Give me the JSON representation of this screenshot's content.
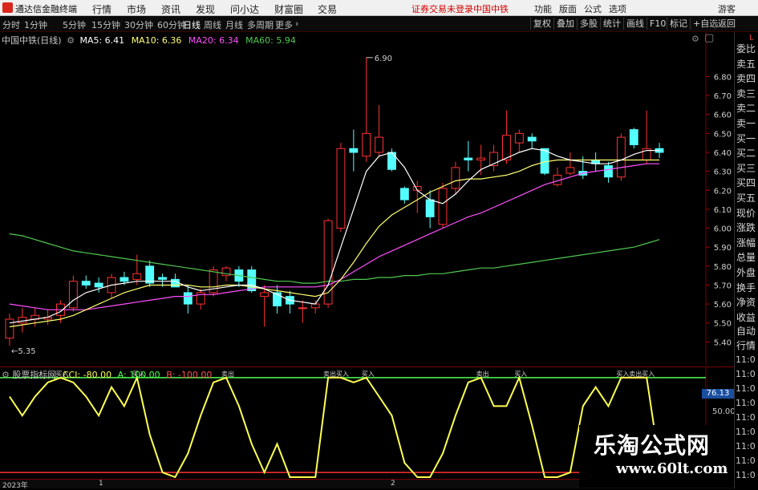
{
  "app": {
    "title": "通达信金融终端",
    "menu": [
      "行情",
      "市场",
      "资讯",
      "发现",
      "问小达",
      "财富圈",
      "交易"
    ],
    "status_text": "证券交易未登录",
    "stock_name_top": "中国中铁",
    "right_menu": [
      "功能",
      "版面",
      "公式",
      "选项"
    ],
    "guest": "游客"
  },
  "toolbar": {
    "periods": [
      "分时",
      "1分钟",
      "5分钟",
      "15分钟",
      "30分钟",
      "60分钟",
      "日线",
      "周线",
      "月线",
      "多周期",
      "更多"
    ],
    "active_period": "日线",
    "right_buttons": [
      "复权",
      "叠加",
      "多股",
      "统计",
      "画线",
      "F10",
      "标记",
      "+自选",
      "返回"
    ]
  },
  "legend": {
    "title": "中国中铁(日线)",
    "ma5": "MA5: 6.41",
    "ma10": "MA10: 6.36",
    "ma20": "MA20: 6.34",
    "ma60": "MA60: 5.94"
  },
  "indicator": {
    "name": "股票指标网",
    "cci": "CCI: -80.00",
    "a": "A: 100.00",
    "b": "B: -100.00",
    "scale_value": "76.13",
    "scale_50": "50.00"
  },
  "colors": {
    "up": "#ff3232",
    "down": "#54ffff",
    "ma5": "#ffffff",
    "ma10": "#ffff70",
    "ma20": "#ff50ff",
    "ma60": "#50c850",
    "cci": "#ffff50",
    "line100": "#50ff50"
  },
  "price_axis": [
    "6.80",
    "6.70",
    "6.60",
    "6.50",
    "6.40",
    "6.30",
    "6.20",
    "6.10",
    "6.00",
    "5.90",
    "5.80",
    "5.70",
    "5.60",
    "5.50",
    "5.40"
  ],
  "high_label": "6.90",
  "low_label": "5.35",
  "cci_markers": [
    "买入",
    "卖出"
  ],
  "sidebar": {
    "items": [
      "委比",
      "卖五",
      "卖四",
      "卖三",
      "卖二",
      "卖一",
      "买一",
      "买二",
      "买三",
      "买四",
      "买五",
      "现价",
      "涨跌",
      "涨幅",
      "总量",
      "外盘",
      "换手",
      "净资",
      "收益"
    ],
    "red_flag": "L",
    "action_items": [
      "自动",
      "行情"
    ],
    "times": [
      "11:0",
      "11:0",
      "11:0",
      "11:0",
      "11:0",
      "11:0",
      "11:0",
      "11:0",
      "11:0"
    ]
  },
  "bottom": {
    "year_label": "2023年",
    "month_labels": [
      "1",
      "2"
    ]
  },
  "watermark": {
    "cn": "乐淘公式网",
    "url": "www.60lt.com"
  },
  "chart_data": {
    "type": "candlestick",
    "title": "中国中铁(日线)",
    "ylim": [
      5.3,
      6.95
    ],
    "candles": [
      {
        "o": 5.42,
        "h": 5.55,
        "l": 5.38,
        "c": 5.52
      },
      {
        "o": 5.5,
        "h": 5.58,
        "l": 5.45,
        "c": 5.53
      },
      {
        "o": 5.52,
        "h": 5.58,
        "l": 5.48,
        "c": 5.54
      },
      {
        "o": 5.52,
        "h": 5.57,
        "l": 5.49,
        "c": 5.53
      },
      {
        "o": 5.54,
        "h": 5.62,
        "l": 5.5,
        "c": 5.6
      },
      {
        "o": 5.58,
        "h": 5.75,
        "l": 5.56,
        "c": 5.72
      },
      {
        "o": 5.72,
        "h": 5.75,
        "l": 5.68,
        "c": 5.7
      },
      {
        "o": 5.71,
        "h": 5.74,
        "l": 5.66,
        "c": 5.69
      },
      {
        "o": 5.66,
        "h": 5.76,
        "l": 5.63,
        "c": 5.74
      },
      {
        "o": 5.74,
        "h": 5.77,
        "l": 5.7,
        "c": 5.72
      },
      {
        "o": 5.73,
        "h": 5.86,
        "l": 5.7,
        "c": 5.76
      },
      {
        "o": 5.8,
        "h": 5.83,
        "l": 5.69,
        "c": 5.71
      },
      {
        "o": 5.74,
        "h": 5.76,
        "l": 5.69,
        "c": 5.73
      },
      {
        "o": 5.73,
        "h": 5.76,
        "l": 5.7,
        "c": 5.69
      },
      {
        "o": 5.66,
        "h": 5.7,
        "l": 5.55,
        "c": 5.6
      },
      {
        "o": 5.6,
        "h": 5.68,
        "l": 5.57,
        "c": 5.66
      },
      {
        "o": 5.66,
        "h": 5.8,
        "l": 5.64,
        "c": 5.78
      },
      {
        "o": 5.75,
        "h": 5.8,
        "l": 5.72,
        "c": 5.79
      },
      {
        "o": 5.78,
        "h": 5.8,
        "l": 5.69,
        "c": 5.72
      },
      {
        "o": 5.78,
        "h": 5.8,
        "l": 5.66,
        "c": 5.67
      },
      {
        "o": 5.64,
        "h": 5.7,
        "l": 5.48,
        "c": 5.66
      },
      {
        "o": 5.66,
        "h": 5.7,
        "l": 5.55,
        "c": 5.59
      },
      {
        "o": 5.64,
        "h": 5.67,
        "l": 5.55,
        "c": 5.6
      },
      {
        "o": 5.58,
        "h": 5.62,
        "l": 5.5,
        "c": 5.58
      },
      {
        "o": 5.58,
        "h": 5.62,
        "l": 5.55,
        "c": 5.6
      },
      {
        "o": 5.6,
        "h": 6.05,
        "l": 5.58,
        "c": 6.04
      },
      {
        "o": 6.0,
        "h": 6.45,
        "l": 5.98,
        "c": 6.42
      },
      {
        "o": 6.42,
        "h": 6.52,
        "l": 6.3,
        "c": 6.4
      },
      {
        "o": 6.38,
        "h": 6.9,
        "l": 6.35,
        "c": 6.5
      },
      {
        "o": 6.4,
        "h": 6.65,
        "l": 6.38,
        "c": 6.48
      },
      {
        "o": 6.4,
        "h": 6.42,
        "l": 6.3,
        "c": 6.31
      },
      {
        "o": 6.21,
        "h": 6.22,
        "l": 6.13,
        "c": 6.15
      },
      {
        "o": 6.2,
        "h": 6.25,
        "l": 6.08,
        "c": 6.22
      },
      {
        "o": 6.15,
        "h": 6.2,
        "l": 6.0,
        "c": 6.06
      },
      {
        "o": 6.02,
        "h": 6.24,
        "l": 6.0,
        "c": 6.21
      },
      {
        "o": 6.21,
        "h": 6.35,
        "l": 6.18,
        "c": 6.32
      },
      {
        "o": 6.37,
        "h": 6.46,
        "l": 6.3,
        "c": 6.36
      },
      {
        "o": 6.36,
        "h": 6.44,
        "l": 6.28,
        "c": 6.37
      },
      {
        "o": 6.33,
        "h": 6.44,
        "l": 6.3,
        "c": 6.4
      },
      {
        "o": 6.36,
        "h": 6.62,
        "l": 6.34,
        "c": 6.49
      },
      {
        "o": 6.45,
        "h": 6.52,
        "l": 6.4,
        "c": 6.5
      },
      {
        "o": 6.48,
        "h": 6.5,
        "l": 6.42,
        "c": 6.46
      },
      {
        "o": 6.42,
        "h": 6.42,
        "l": 6.28,
        "c": 6.29
      },
      {
        "o": 6.23,
        "h": 6.32,
        "l": 6.22,
        "c": 6.28
      },
      {
        "o": 6.29,
        "h": 6.4,
        "l": 6.28,
        "c": 6.32
      },
      {
        "o": 6.3,
        "h": 6.38,
        "l": 6.26,
        "c": 6.28
      },
      {
        "o": 6.36,
        "h": 6.4,
        "l": 6.3,
        "c": 6.34
      },
      {
        "o": 6.33,
        "h": 6.35,
        "l": 6.24,
        "c": 6.27
      },
      {
        "o": 6.27,
        "h": 6.5,
        "l": 6.25,
        "c": 6.48
      },
      {
        "o": 6.52,
        "h": 6.53,
        "l": 6.42,
        "c": 6.44
      },
      {
        "o": 6.36,
        "h": 6.62,
        "l": 6.34,
        "c": 6.42
      },
      {
        "o": 6.42,
        "h": 6.45,
        "l": 6.37,
        "c": 6.4
      }
    ],
    "ma5": [
      5.5,
      5.51,
      5.52,
      5.53,
      5.56,
      5.62,
      5.66,
      5.68,
      5.7,
      5.71,
      5.72,
      5.72,
      5.72,
      5.72,
      5.69,
      5.67,
      5.68,
      5.69,
      5.7,
      5.7,
      5.68,
      5.65,
      5.62,
      5.61,
      5.6,
      5.7,
      5.9,
      6.1,
      6.3,
      6.38,
      6.4,
      6.32,
      6.2,
      6.15,
      6.13,
      6.18,
      6.25,
      6.31,
      6.34,
      6.37,
      6.4,
      6.42,
      6.41,
      6.38,
      6.36,
      6.35,
      6.34,
      6.34,
      6.36,
      6.39,
      6.41,
      6.41
    ],
    "ma10": [
      5.48,
      5.49,
      5.5,
      5.51,
      5.52,
      5.54,
      5.57,
      5.6,
      5.63,
      5.66,
      5.68,
      5.7,
      5.7,
      5.7,
      5.7,
      5.69,
      5.69,
      5.7,
      5.7,
      5.69,
      5.68,
      5.67,
      5.66,
      5.65,
      5.64,
      5.66,
      5.73,
      5.82,
      5.92,
      6.01,
      6.07,
      6.11,
      6.15,
      6.19,
      6.22,
      6.25,
      6.26,
      6.26,
      6.27,
      6.28,
      6.3,
      6.33,
      6.35,
      6.36,
      6.36,
      6.36,
      6.36,
      6.36,
      6.36,
      6.36,
      6.36,
      6.36
    ],
    "ma20": [
      5.6,
      5.59,
      5.58,
      5.57,
      5.57,
      5.57,
      5.57,
      5.58,
      5.59,
      5.6,
      5.61,
      5.62,
      5.63,
      5.64,
      5.64,
      5.65,
      5.65,
      5.66,
      5.67,
      5.68,
      5.69,
      5.69,
      5.69,
      5.69,
      5.69,
      5.7,
      5.73,
      5.77,
      5.81,
      5.85,
      5.88,
      5.91,
      5.94,
      5.97,
      6.0,
      6.03,
      6.06,
      6.08,
      6.11,
      6.14,
      6.17,
      6.2,
      6.23,
      6.25,
      6.27,
      6.29,
      6.3,
      6.31,
      6.32,
      6.33,
      6.34,
      6.34
    ],
    "ma60": [
      5.97,
      5.96,
      5.94,
      5.92,
      5.9,
      5.88,
      5.87,
      5.86,
      5.85,
      5.84,
      5.83,
      5.82,
      5.81,
      5.8,
      5.79,
      5.78,
      5.77,
      5.76,
      5.75,
      5.74,
      5.73,
      5.72,
      5.72,
      5.71,
      5.71,
      5.72,
      5.72,
      5.73,
      5.73,
      5.74,
      5.74,
      5.75,
      5.75,
      5.76,
      5.76,
      5.77,
      5.78,
      5.79,
      5.79,
      5.8,
      5.81,
      5.82,
      5.83,
      5.84,
      5.85,
      5.86,
      5.87,
      5.88,
      5.89,
      5.9,
      5.92,
      5.94
    ],
    "cci": [
      60,
      20,
      60,
      90,
      100,
      90,
      60,
      20,
      80,
      40,
      100,
      -20,
      -100,
      -110,
      -60,
      20,
      90,
      100,
      40,
      -40,
      -100,
      -40,
      -110,
      -110,
      -110,
      100,
      100,
      90,
      100,
      60,
      20,
      -80,
      -110,
      -110,
      -60,
      20,
      90,
      100,
      40,
      40,
      100,
      0,
      -110,
      -110,
      -100,
      40,
      80,
      40,
      100,
      100,
      100,
      -80
    ],
    "cci_ylim": [
      -110,
      110
    ]
  }
}
